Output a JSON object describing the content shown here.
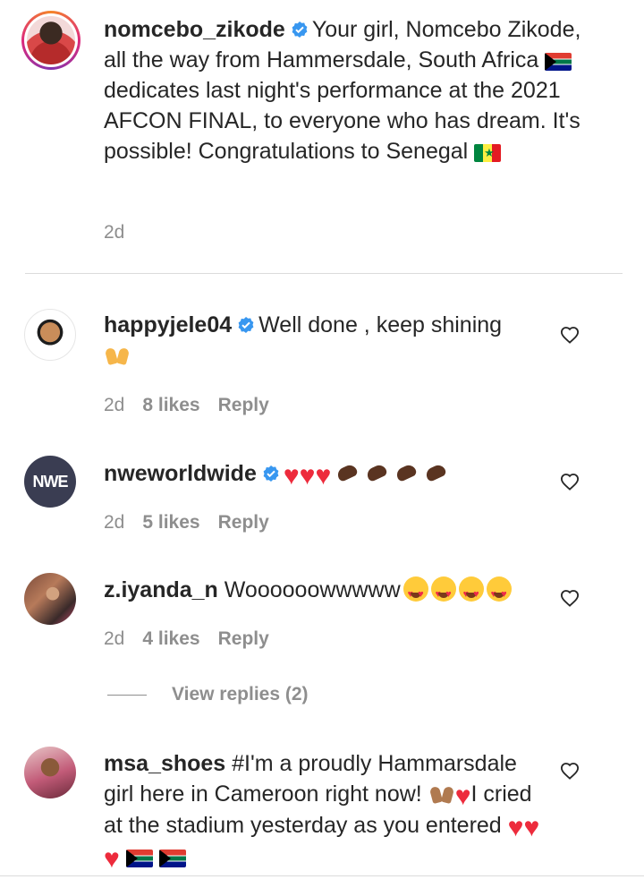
{
  "post_caption": {
    "username": "nomcebo_zikode",
    "text_1": "Your girl, Nomcebo Zikode, all the way from Hammersdale, South Africa",
    "text_2": "dedicates last night's performance at the 2021 AFCON FINAL, to everyone who has dream. It's possible! Congratulations to Senegal",
    "time": "2d"
  },
  "comments": [
    {
      "username": "happyjele04",
      "text": "Well done , keep shining",
      "time": "2d",
      "likes": "8 likes",
      "reply": "Reply",
      "emojis": [
        "raising-hands"
      ]
    },
    {
      "username": "nweworldwide",
      "avatar_text": "NWE",
      "text": "",
      "time": "2d",
      "likes": "5 likes",
      "reply": "Reply",
      "emojis": [
        "red-heart",
        "red-heart",
        "red-heart",
        "clapping-hands",
        "clapping-hands",
        "clapping-hands",
        "clapping-hands"
      ]
    },
    {
      "username": "z.iyanda_n",
      "text": "Woooooowwwww",
      "time": "2d",
      "likes": "4 likes",
      "reply": "Reply",
      "emojis": [
        "heart-eyes-face",
        "heart-eyes-face",
        "heart-eyes-face",
        "heart-eyes-face"
      ]
    },
    {
      "username": "msa_shoes",
      "text_1": "#I'm a proudly Hammarsdale girl here in Cameroon right now!",
      "text_2": "I cried at the stadium yesterday as you entered",
      "emojis": [
        "raising-hands-medium",
        "red-heart",
        "red-heart",
        "red-heart",
        "red-heart",
        "flag-south-africa",
        "flag-south-africa"
      ]
    }
  ],
  "view_replies": "View replies (2)",
  "colors": {
    "text": "#262626",
    "muted": "#8e8e8e",
    "verified": "#3897f0",
    "divider": "#dbdbdb"
  }
}
